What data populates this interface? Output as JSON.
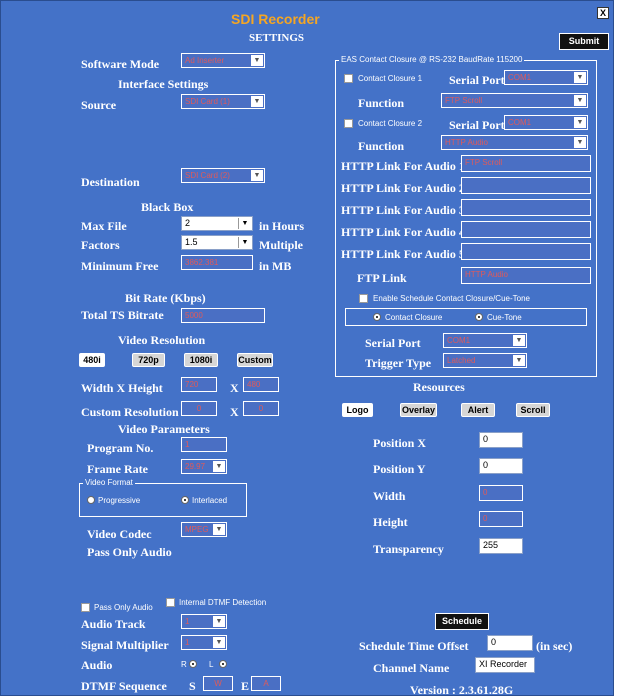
{
  "window": {
    "title": "SDI Recorder",
    "subtitle": "SETTINGS",
    "close_label": "X",
    "submit_label": "Submit"
  },
  "left": {
    "software_mode": {
      "label": "Software Mode",
      "value": "Ad Inserter"
    },
    "interface_settings": "Interface Settings",
    "source": {
      "label": "Source",
      "value": "SDI Card (1)"
    },
    "destination": {
      "label": "Destination",
      "value": "SDI Card (2)"
    },
    "black_box": {
      "title": "Black Box",
      "max_file_label": "Max File",
      "max_file_value": "2",
      "max_file_unit": "in Hours",
      "factors_label": "Factors",
      "factors_value": "1.5",
      "factors_unit": "Multiple",
      "min_free_label": "Minimum Free",
      "min_free_value": "3862.381",
      "min_free_unit": "in MB"
    },
    "bit_rate": {
      "title": "Bit Rate (Kbps)",
      "total_label": "Total TS Bitrate",
      "total_value": "5000"
    },
    "video_resolution": {
      "title": "Video Resolution",
      "buttons": [
        "480i",
        "720p",
        "1080i",
        "Custom"
      ],
      "wh_label": "Width  X Height",
      "width": "720",
      "x": "X",
      "height": "480",
      "custom_label": "Custom Resolution",
      "custom_w": "0",
      "custom_h": "0"
    },
    "video_parameters": {
      "title": "Video Parameters",
      "program_label": "Program No.",
      "program_value": "1",
      "frame_rate_label": "Frame Rate",
      "frame_rate_value": "29.97",
      "video_format_legend": "Video Format",
      "progressive": "Progressive",
      "interlaced": "Interlaced",
      "codec_label": "Video Codec",
      "codec_value": "MPEG",
      "pass_only_audio": "Pass Only Audio"
    },
    "bottom": {
      "pass_only_audio_chk": "Pass Only Audio",
      "internal_dtmf": "Internal DTMF Detection",
      "audio_track_label": "Audio Track",
      "audio_track_value": "1",
      "signal_mult_label": "Signal Multiplier",
      "signal_mult_value": "1",
      "audio_label": "Audio",
      "audio_r": "R",
      "audio_l": "L",
      "dtmf_label": "DTMF Sequence",
      "dtmf_s": "S",
      "dtmf_s_value": "W",
      "dtmf_e": "E",
      "dtmf_e_value": "A"
    }
  },
  "right": {
    "eas_legend": "EAS Contact Closure @ RS-232 BaudRate 115200",
    "cc1": {
      "label": "Contact Closure 1",
      "serial_label": "Serial Port",
      "serial_value": "COM1",
      "function_label": "Function",
      "function_value": "FTP Scroll"
    },
    "cc2": {
      "label": "Contact Closure 2",
      "serial_label": "Serial Port",
      "serial_value": "COM1",
      "function_label": "Function",
      "function_value": "HTTP Audio"
    },
    "http_links": [
      {
        "label": "HTTP Link For Audio 1",
        "value": "FTP Scroll"
      },
      {
        "label": "HTTP Link For Audio 2",
        "value": ""
      },
      {
        "label": "HTTP Link For Audio 3",
        "value": ""
      },
      {
        "label": "HTTP Link For Audio 4",
        "value": ""
      },
      {
        "label": "HTTP Link For Audio 5",
        "value": ""
      }
    ],
    "ftp_link": {
      "label": "FTP Link",
      "value": "HTTP Audio"
    },
    "schedule": {
      "enable_label": "Enable Schedule Contact Closure/Cue-Tone",
      "contact_closure": "Contact Closure",
      "cue_tone": "Cue-Tone",
      "serial_label": "Serial Port",
      "serial_value": "COM1",
      "trigger_label": "Trigger Type",
      "trigger_value": "Latched"
    },
    "resources": {
      "title": "Resources",
      "buttons": [
        "Logo",
        "Overlay",
        "Alert",
        "Scroll"
      ],
      "pos_x_label": "Position X",
      "pos_x": "0",
      "pos_y_label": "Position Y",
      "pos_y": "0",
      "width_label": "Width",
      "width": "0",
      "height_label": "Height",
      "height": "0",
      "transparency_label": "Transparency",
      "transparency": "255"
    },
    "schedule_btn": "Schedule",
    "time_offset_label": "Schedule Time Offset",
    "time_offset_value": "0",
    "time_offset_unit": "(in sec)",
    "channel_label": "Channel Name",
    "channel_value": "XI Recorder",
    "version": "Version : 2.3.61.28G"
  }
}
